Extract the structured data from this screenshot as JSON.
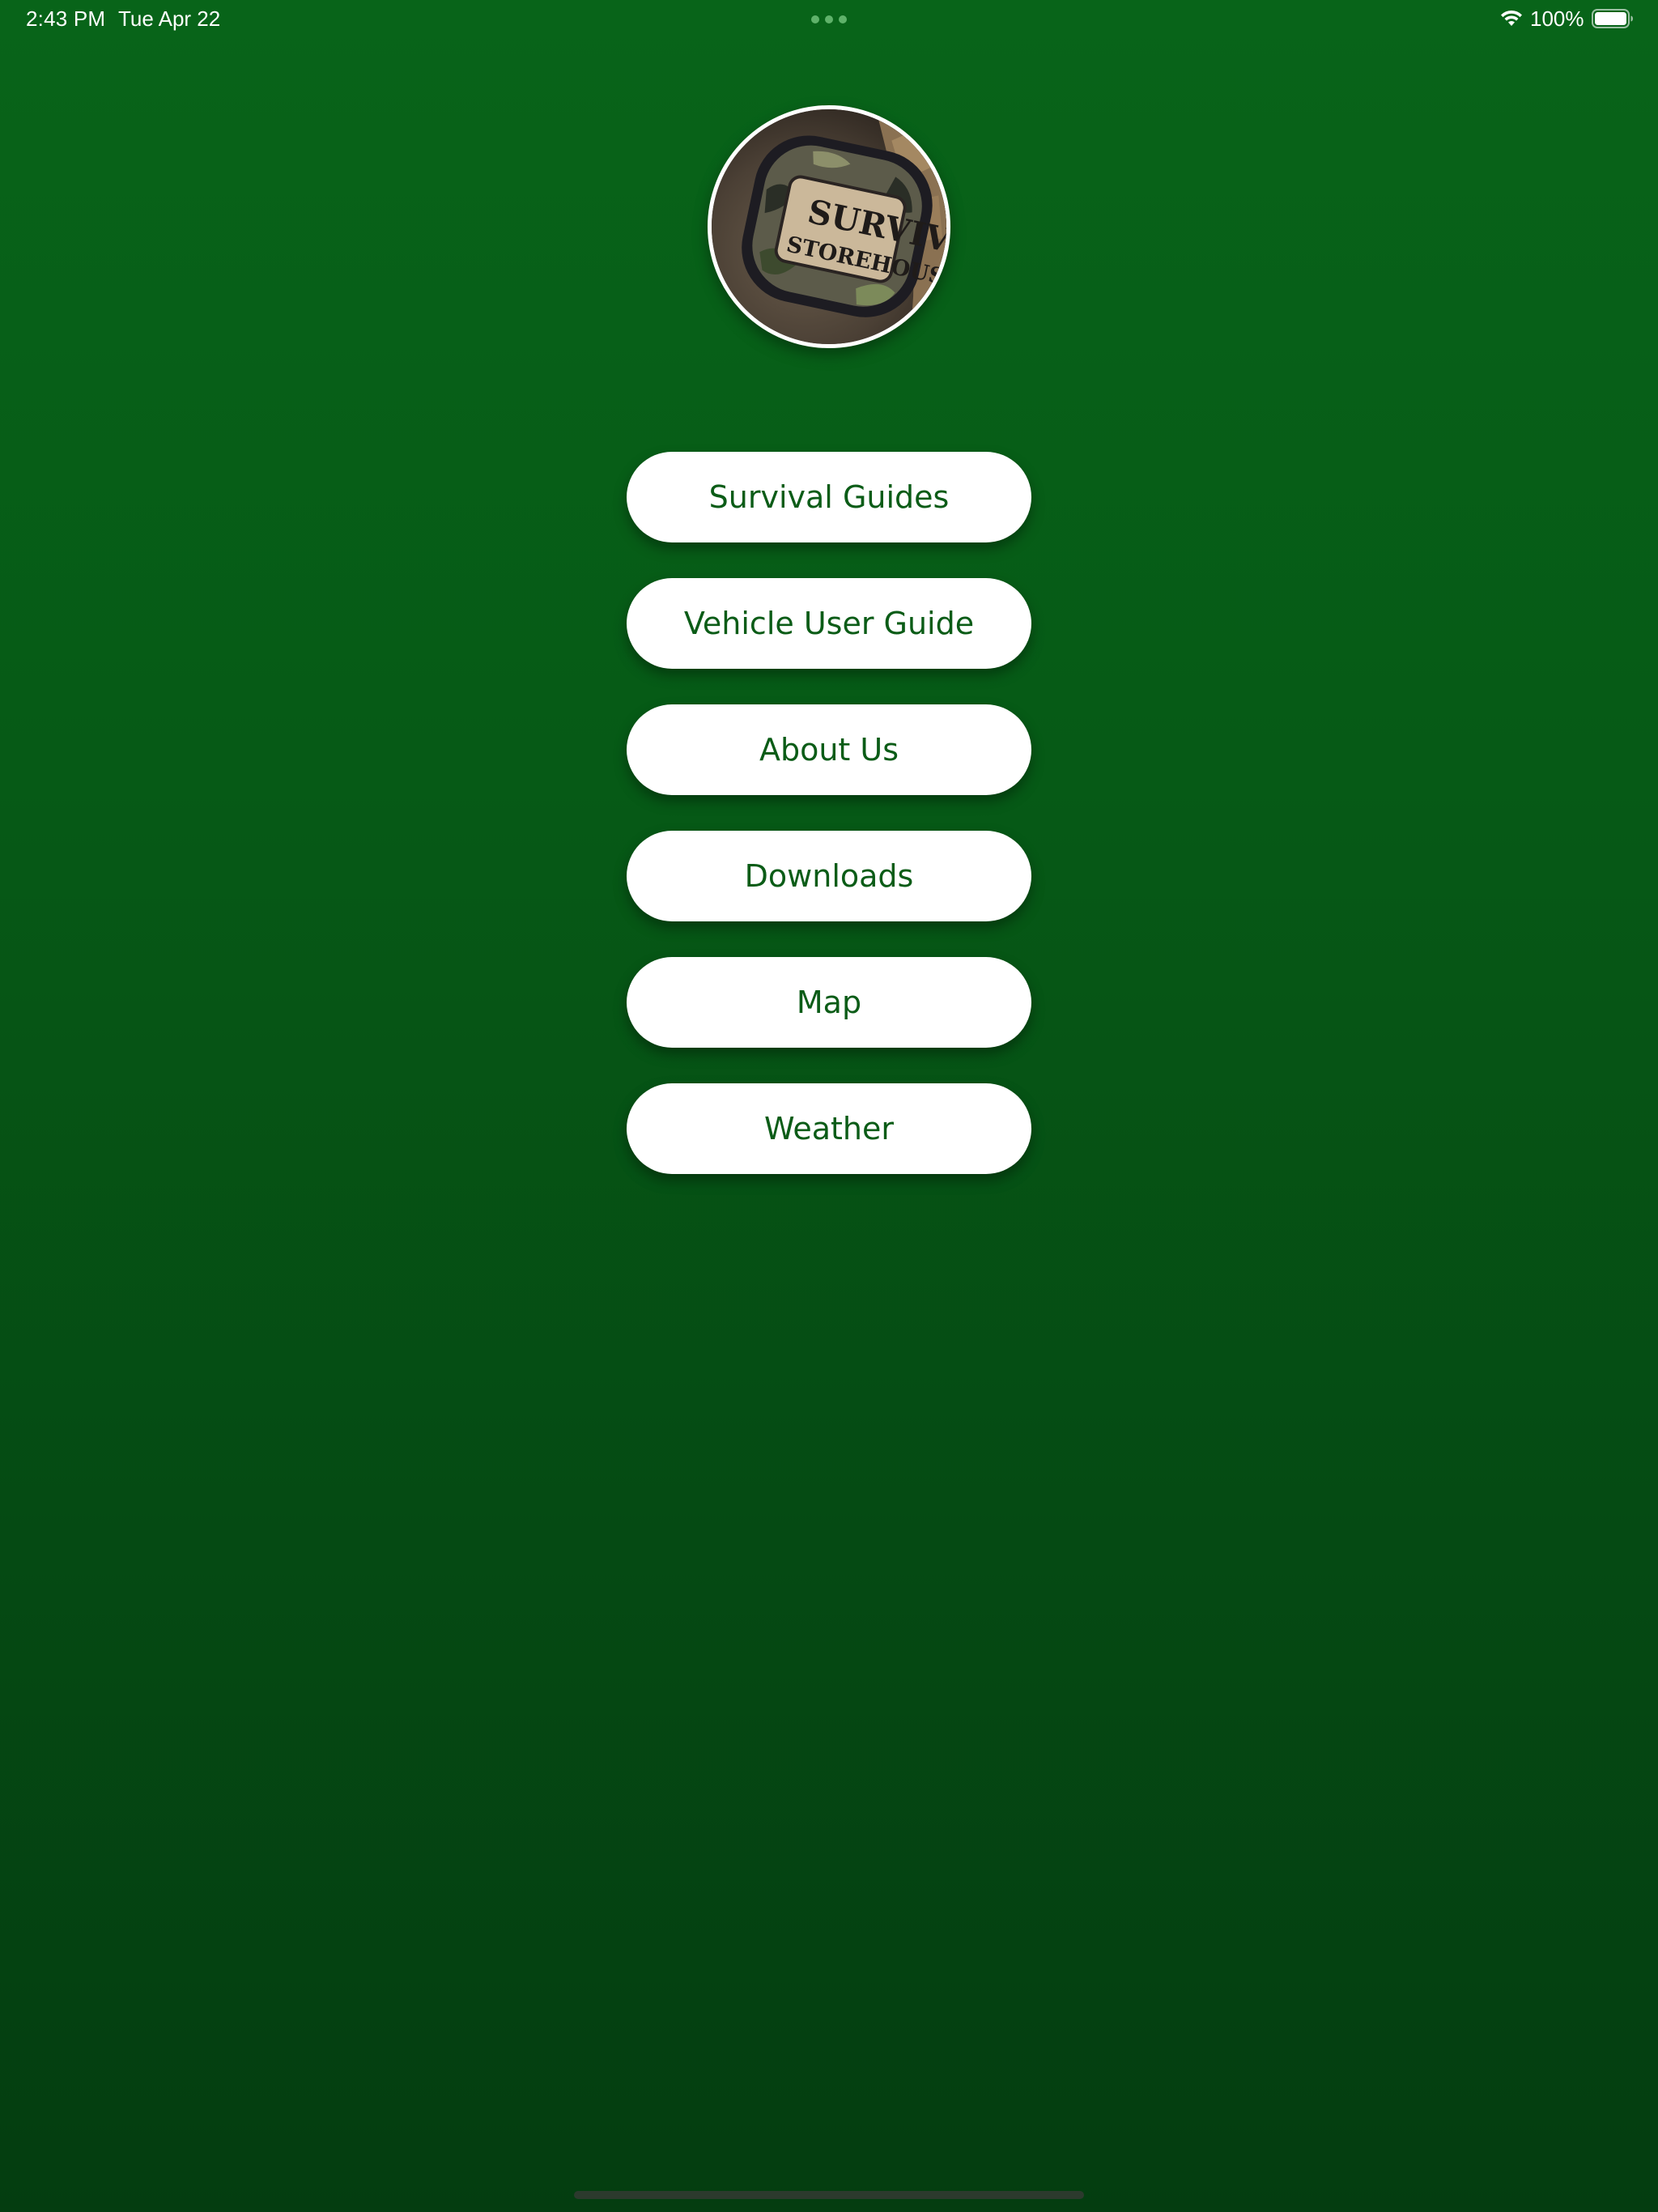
{
  "status_bar": {
    "time": "2:43 PM",
    "date": "Tue Apr 22",
    "battery_percent": "100%",
    "wifi_icon": "wifi-icon",
    "battery_icon": "battery-full-icon",
    "battery_level": 1.0
  },
  "logo": {
    "alt": "Survival Storehouse logo",
    "text_line1": "SURVIVAL",
    "text_line2": "STOREHOUSE.com",
    "border_color": "#ffffff"
  },
  "menu": {
    "items": [
      {
        "label": "Survival Guides"
      },
      {
        "label": "Vehicle User Guide"
      },
      {
        "label": "About Us"
      },
      {
        "label": "Downloads"
      },
      {
        "label": "Map"
      },
      {
        "label": "Weather"
      }
    ]
  },
  "colors": {
    "background_top": "#086419",
    "background_bottom": "#043d10",
    "button_bg": "#ffffff",
    "button_text": "#0b5c17"
  }
}
